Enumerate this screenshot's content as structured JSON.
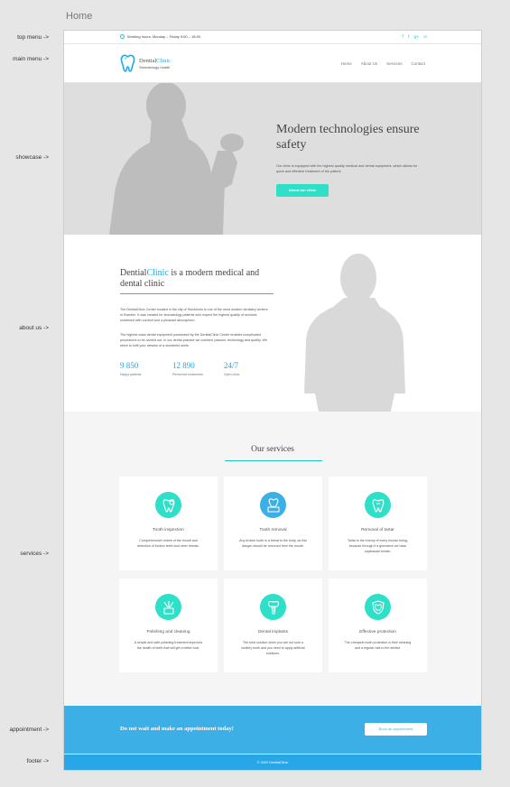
{
  "page_title": "Home",
  "side_labels": {
    "top_menu": "top menu ->",
    "main_menu": "main menu ->",
    "showcase": "showcase ->",
    "about_us": "about us ->",
    "services": "services ->",
    "appointment": "appointment ->",
    "footer": "footer ->"
  },
  "topmenu": {
    "hours": "Working hours: Monday – Friday 9:00 – 18:00",
    "social": [
      "f",
      "t",
      "g+",
      "in"
    ]
  },
  "logo": {
    "name_a": "Dential",
    "name_b": "Clinic",
    "tagline": "Stomatology health"
  },
  "nav": [
    "Home",
    "About Us",
    "Services",
    "Contact"
  ],
  "showcase": {
    "heading": "Modern technologies ensure safety",
    "text": "Our clinic is equipped with the highest quality medical and dental equipment, which allows for quick and effective treatment of the patient.",
    "button": "About our clinic"
  },
  "about": {
    "heading_a": "Dential",
    "heading_b": "Clinic",
    "heading_c": " is a modern medical and dental clinic",
    "p1": "The DentialClinic Center located in the city of Stockholm is one of the most modern dentistry centers in Sweden. It was created for stomatology patients who expect the highest quality of services combined with comfort and a pleasant atmosphere.",
    "p2": "The highest class dental equipment possessed by the DentialClinic Center enables complicated procedures to be carried out. In our dental practice we combine passion, technology and quality. We strive to fulfil your dreams of a wonderful smile.",
    "stats": [
      {
        "num": "9 850",
        "cap": "Happy patients"
      },
      {
        "num": "12 890",
        "cap": "Performed treatments"
      },
      {
        "num": "24/7",
        "cap": "Open clinic"
      }
    ]
  },
  "services": {
    "heading": "Our services",
    "cards": [
      {
        "title": "Tooth inspection",
        "desc": "Comprehensive review of the mouth and detection of broken teeth and other threats.",
        "icon": "tooth-inspection-icon",
        "color": "#2ee0c8"
      },
      {
        "title": "Tooth removal",
        "desc": "Any broken tooth is a threat to the body, as this danger should be removed from the mouth.",
        "icon": "tooth-removal-icon",
        "color": "#3bafe6"
      },
      {
        "title": "Removal of tartar",
        "desc": "Tartar is the enemy of every human being, because through it a grievance we have unpleasant breath.",
        "icon": "tartar-icon",
        "color": "#2ee0c8"
      },
      {
        "title": "Polishing and cleaning",
        "desc": "A simple and safe polishing treatment improves the health of teeth that will get a better look.",
        "icon": "polishing-icon",
        "color": "#2ee0c8"
      },
      {
        "title": "Dental implants",
        "desc": "The best solution when you are not sure a healthy tooth and you need to apply artificial solutions.",
        "icon": "implant-icon",
        "color": "#2ee0c8"
      },
      {
        "title": "Effective protection",
        "desc": "The cheapest tooth protection is their cleaning and a regular visit to the dentist.",
        "icon": "shield-tooth-icon",
        "color": "#2ee0c8"
      }
    ]
  },
  "appointment": {
    "text": "Do not wait and make an appointment today!",
    "button": "Book an appointment"
  },
  "footer": {
    "text": "© 2020 DentialClinic"
  },
  "colors": {
    "teal": "#2ee0c8",
    "blue": "#3bafe6",
    "footer_blue": "#29a6e6",
    "showcase_bg": "#dedede"
  }
}
